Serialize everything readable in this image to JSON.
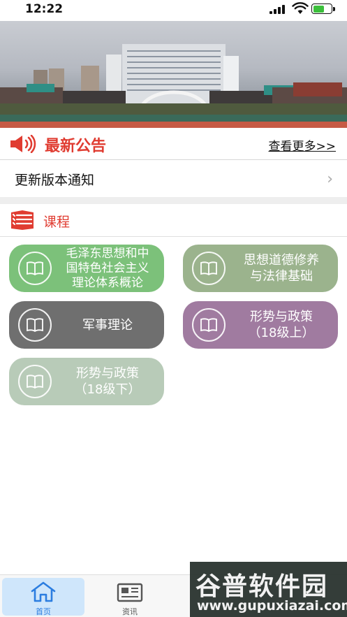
{
  "status_bar": {
    "time": "12:22"
  },
  "notice": {
    "title": "最新公告",
    "more_link": "查看更多>>",
    "items": [
      {
        "title": "更新版本通知"
      }
    ]
  },
  "courses": {
    "title": "课程",
    "items": [
      {
        "label": "毛泽东思想和中\n国特色社会主义\n理论体系概论",
        "color": "#7cc17a"
      },
      {
        "label": "思想道德修养\n与法律基础",
        "color": "#9bb38d"
      },
      {
        "label": "军事理论",
        "color": "#6f6f6f"
      },
      {
        "label": "形势与政策\n（18级上）",
        "color": "#a07ba0"
      },
      {
        "label": "形势与政策\n（18级下）",
        "color": "#b8cbb8"
      }
    ]
  },
  "tabbar": {
    "tabs": [
      {
        "label": "首页",
        "active": true
      },
      {
        "label": "资讯",
        "active": false
      }
    ]
  },
  "watermark": {
    "brand": "谷普软件园",
    "url": "www.gupuxiazai.com"
  },
  "colors": {
    "accent_red": "#e03c31",
    "tab_active": "#2b7de0"
  }
}
